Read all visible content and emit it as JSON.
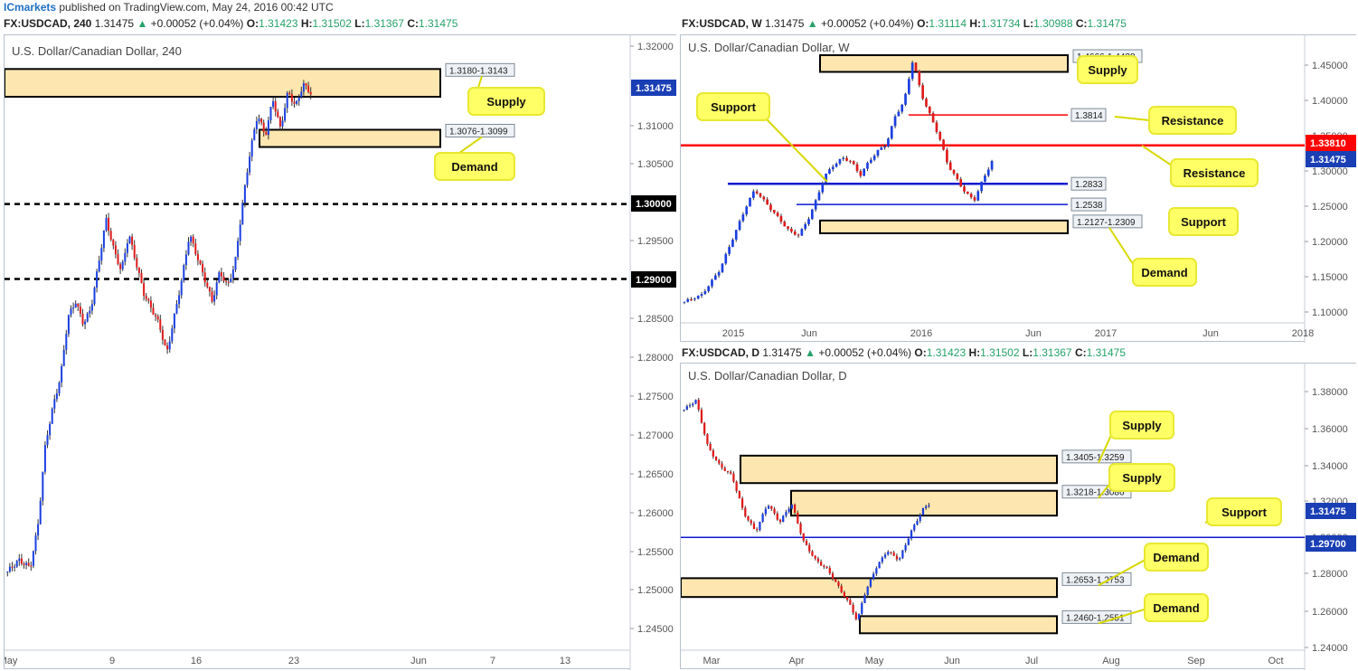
{
  "header": {
    "brand": "ICmarkets",
    "published": "published on TradingView.com, May 24, 2016 00:42 UTC"
  },
  "colors": {
    "up": "#1a3fe0",
    "down": "#e01a1a",
    "zone_fill": "#fde6b0",
    "zone_border": "#000000",
    "callout_fill": "#ffff66",
    "callout_border": "#e8e832",
    "price_tag": "#1a3fb5",
    "resistance_line": "#ff0000",
    "support_line": "#0f1ad0"
  },
  "chart_data": [
    {
      "type": "candlestick",
      "header": {
        "symbol": "FX:USDCAD, 240",
        "last": "1.31475",
        "change": "+0.00052 (+0.04%)",
        "o": "1.31423",
        "h": "1.31502",
        "l": "1.31367",
        "c": "1.31475"
      },
      "title": "U.S. Dollar/Canadian Dollar, 240",
      "ylim": [
        1.2405,
        1.3225
      ],
      "y_ticks": [
        "1.32000",
        "1.31000",
        "1.30500",
        "1.29500",
        "1.28500",
        "1.28000",
        "1.27500",
        "1.27000",
        "1.26500",
        "1.26000",
        "1.25500",
        "1.25000",
        "1.24500"
      ],
      "x_ticks": [
        "May",
        "9",
        "16",
        "23",
        "Jun",
        "7",
        "13"
      ],
      "price_tags": [
        {
          "label": "1.31475",
          "value": 1.31475,
          "style": "blue"
        },
        {
          "label": "1.30000",
          "value": 1.3,
          "style": "black"
        },
        {
          "label": "1.29000",
          "value": 1.29,
          "style": "black"
        }
      ],
      "lines": [
        {
          "value": 1.3,
          "style": "dashed"
        },
        {
          "value": 1.29,
          "style": "dashed"
        }
      ],
      "zones": [
        {
          "high": 1.318,
          "low": 1.3143,
          "label": "1.3180-1.3143",
          "callout": "Supply"
        },
        {
          "high": 1.3099,
          "low": 1.3076,
          "label": "1.3076-1.3099",
          "callout": "Demand"
        }
      ],
      "series_path": [
        [
          0,
          1.251
        ],
        [
          3,
          1.2525
        ],
        [
          6,
          1.2515
        ],
        [
          8,
          1.257
        ],
        [
          10,
          1.268
        ],
        [
          12,
          1.273
        ],
        [
          14,
          1.277
        ],
        [
          16,
          1.285
        ],
        [
          18,
          1.287
        ],
        [
          20,
          1.284
        ],
        [
          22,
          1.286
        ],
        [
          24,
          1.292
        ],
        [
          26,
          1.298
        ],
        [
          28,
          1.294
        ],
        [
          30,
          1.291
        ],
        [
          32,
          1.296
        ],
        [
          34,
          1.292
        ],
        [
          36,
          1.288
        ],
        [
          38,
          1.286
        ],
        [
          40,
          1.284
        ],
        [
          42,
          1.28
        ],
        [
          44,
          1.285
        ],
        [
          46,
          1.29
        ],
        [
          48,
          1.296
        ],
        [
          50,
          1.293
        ],
        [
          52,
          1.29
        ],
        [
          54,
          1.287
        ],
        [
          56,
          1.291
        ],
        [
          58,
          1.289
        ],
        [
          60,
          1.292
        ],
        [
          62,
          1.3
        ],
        [
          64,
          1.307
        ],
        [
          66,
          1.312
        ],
        [
          68,
          1.309
        ],
        [
          70,
          1.314
        ],
        [
          72,
          1.31
        ],
        [
          74,
          1.315
        ],
        [
          76,
          1.313
        ],
        [
          78,
          1.316
        ],
        [
          80,
          1.3148
        ]
      ]
    },
    {
      "type": "candlestick",
      "header": {
        "symbol": "FX:USDCAD, W",
        "last": "1.31475",
        "change": "+0.00052 (+0.04%)",
        "o": "1.31114",
        "h": "1.31734",
        "l": "1.30988",
        "c": "1.31475"
      },
      "title": "U.S. Dollar/Canadian Dollar, W",
      "ylim": [
        1.085,
        1.495
      ],
      "y_ticks": [
        "1.45000",
        "1.40000",
        "1.35000",
        "1.30000",
        "1.25000",
        "1.20000",
        "1.15000",
        "1.10000"
      ],
      "x_ticks": [
        "2015",
        "Jun",
        "2016",
        "Jun",
        "2017",
        "Jun",
        "2018"
      ],
      "price_tags": [
        {
          "label": "1.33810",
          "value": 1.3381,
          "style": "red"
        },
        {
          "label": "1.31475",
          "value": 1.31475,
          "style": "blue"
        }
      ],
      "lines": [
        {
          "value": 1.3381,
          "style": "resistance-red-thick"
        },
        {
          "value": 1.3814,
          "style": "resistance-red-short",
          "label": "1.3814",
          "callout": "Resistance"
        },
        {
          "value": 1.2833,
          "style": "support-blue-thick",
          "label": "1.2833"
        },
        {
          "value": 1.2538,
          "style": "support-blue-thin",
          "label": "1.2538",
          "callout": "Support"
        }
      ],
      "zones": [
        {
          "high": 1.4666,
          "low": 1.4428,
          "label": "1.4666-1.4428",
          "callout": "Supply"
        },
        {
          "high": 1.2309,
          "low": 1.2127,
          "label": "1.2127-1.2309",
          "callout": "Demand"
        }
      ],
      "callouts": [
        "Support",
        "Resistance"
      ],
      "series_path": [
        [
          0,
          1.115
        ],
        [
          4,
          1.125
        ],
        [
          8,
          1.16
        ],
        [
          12,
          1.22
        ],
        [
          14,
          1.25
        ],
        [
          16,
          1.275
        ],
        [
          18,
          1.26
        ],
        [
          20,
          1.245
        ],
        [
          22,
          1.23
        ],
        [
          24,
          1.215
        ],
        [
          26,
          1.21
        ],
        [
          28,
          1.23
        ],
        [
          30,
          1.26
        ],
        [
          32,
          1.295
        ],
        [
          34,
          1.31
        ],
        [
          36,
          1.32
        ],
        [
          38,
          1.315
        ],
        [
          40,
          1.295
        ],
        [
          42,
          1.315
        ],
        [
          44,
          1.33
        ],
        [
          46,
          1.34
        ],
        [
          48,
          1.38
        ],
        [
          50,
          1.4
        ],
        [
          52,
          1.46
        ],
        [
          54,
          1.41
        ],
        [
          56,
          1.38
        ],
        [
          58,
          1.35
        ],
        [
          60,
          1.31
        ],
        [
          62,
          1.29
        ],
        [
          64,
          1.27
        ],
        [
          66,
          1.26
        ],
        [
          68,
          1.29
        ],
        [
          70,
          1.315
        ]
      ]
    },
    {
      "type": "candlestick",
      "header": {
        "symbol": "FX:USDCAD, D",
        "last": "1.31475",
        "change": "+0.00052 (+0.04%)",
        "o": "1.31423",
        "h": "1.31502",
        "l": "1.31367",
        "c": "1.31475"
      },
      "title": "U.S. Dollar/Canadian Dollar, D",
      "ylim": [
        1.237,
        1.3895
      ],
      "y_ticks": [
        "1.38000",
        "1.36000",
        "1.34000",
        "1.32000",
        "1.30000",
        "1.28000",
        "1.26000",
        "1.24000"
      ],
      "x_ticks": [
        "Mar",
        "Apr",
        "May",
        "Jun",
        "Jul",
        "Aug",
        "Sep",
        "Oct"
      ],
      "price_tags": [
        {
          "label": "1.31475",
          "value": 1.31475,
          "style": "blue"
        },
        {
          "label": "1.29700",
          "value": 1.297,
          "style": "blue"
        }
      ],
      "lines": [
        {
          "value": 1.297,
          "style": "support-blue",
          "callout": "Support"
        }
      ],
      "zones": [
        {
          "high": 1.3405,
          "low": 1.3259,
          "label": "1.3405-1.3259",
          "callout": "Supply"
        },
        {
          "high": 1.3218,
          "low": 1.3086,
          "label": "1.3218-1.3086",
          "callout": "Supply"
        },
        {
          "high": 1.2753,
          "low": 1.2653,
          "label": "1.2653-1.2753",
          "callout": "Demand"
        },
        {
          "high": 1.2551,
          "low": 1.246,
          "label": "1.2460-1.2551",
          "callout": "Demand"
        }
      ],
      "series_path": [
        [
          0,
          1.365
        ],
        [
          4,
          1.37
        ],
        [
          8,
          1.345
        ],
        [
          12,
          1.335
        ],
        [
          16,
          1.33
        ],
        [
          20,
          1.31
        ],
        [
          24,
          1.3
        ],
        [
          28,
          1.315
        ],
        [
          32,
          1.305
        ],
        [
          36,
          1.315
        ],
        [
          40,
          1.295
        ],
        [
          44,
          1.285
        ],
        [
          48,
          1.28
        ],
        [
          52,
          1.27
        ],
        [
          56,
          1.26
        ],
        [
          58,
          1.252
        ],
        [
          60,
          1.265
        ],
        [
          64,
          1.28
        ],
        [
          68,
          1.29
        ],
        [
          72,
          1.285
        ],
        [
          76,
          1.3
        ],
        [
          80,
          1.312
        ],
        [
          82,
          1.3148
        ]
      ]
    }
  ]
}
